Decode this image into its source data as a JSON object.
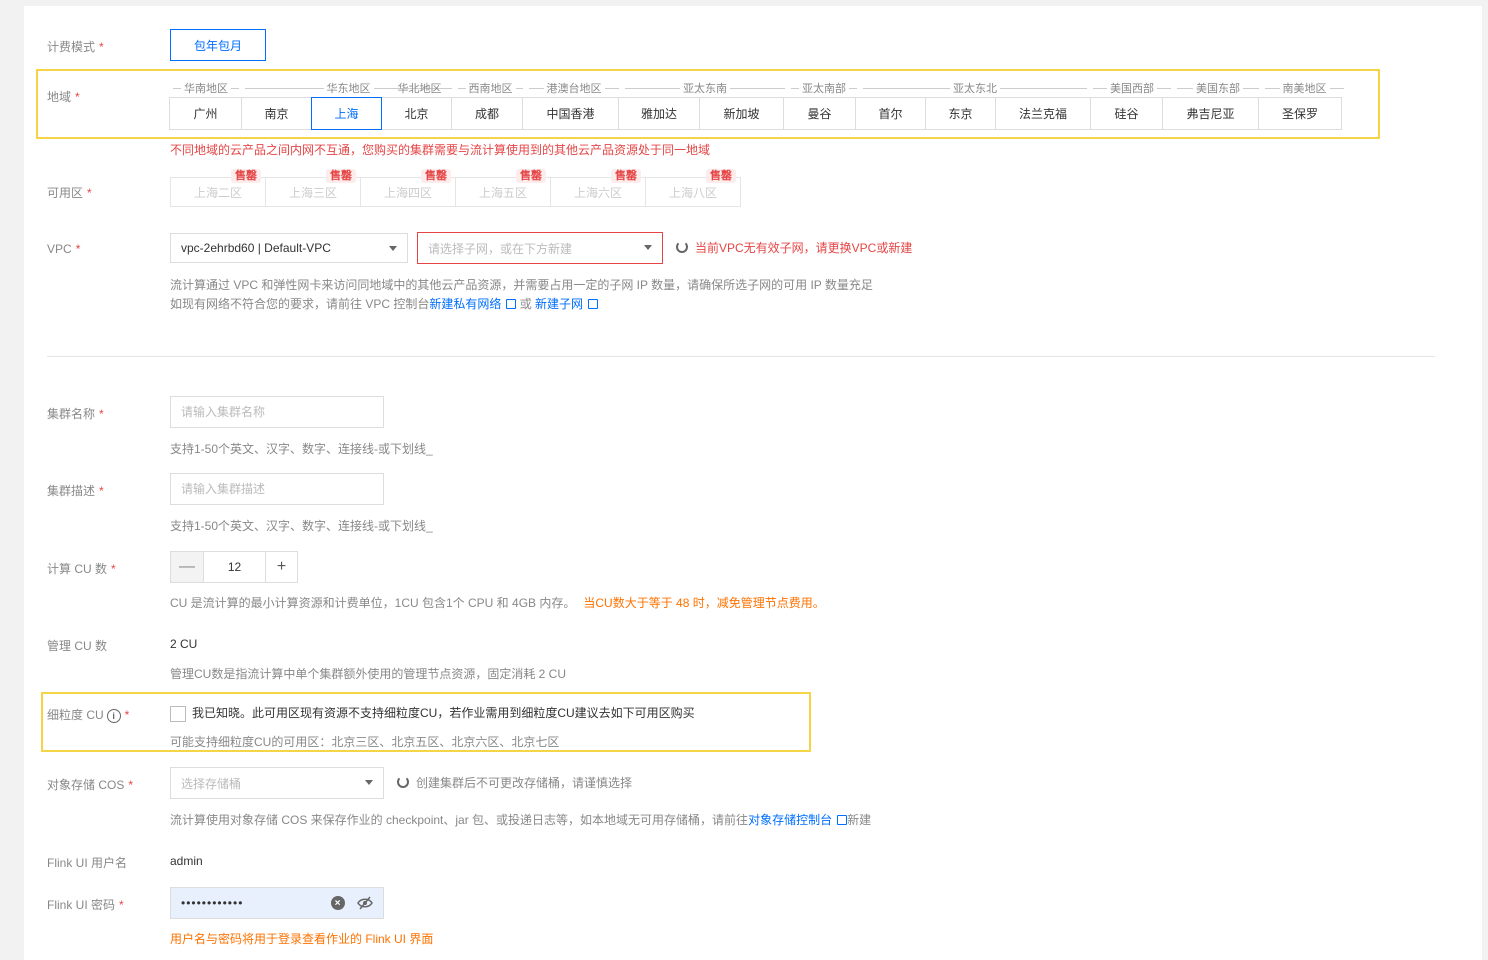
{
  "billing": {
    "label": "计费模式",
    "option": "包年包月"
  },
  "region": {
    "label": "地域",
    "groups": [
      "华南地区",
      "华东地区",
      "华北地区",
      "西南地区",
      "港澳台地区",
      "亚太东南",
      "亚太南部",
      "亚太东北",
      "美国西部",
      "美国东部",
      "南美地区"
    ],
    "items": [
      "广州",
      "南京",
      "上海",
      "北京",
      "成都",
      "中国香港",
      "雅加达",
      "新加坡",
      "曼谷",
      "首尔",
      "东京",
      "法兰克福",
      "硅谷",
      "弗吉尼亚",
      "圣保罗"
    ],
    "selected": "上海",
    "note": "不同地域的云产品之间内网不互通，您购买的集群需要与流计算使用到的其他云产品资源处于同一地域"
  },
  "zone": {
    "label": "可用区",
    "items": [
      "上海二区",
      "上海三区",
      "上海四区",
      "上海五区",
      "上海六区",
      "上海八区"
    ],
    "badge": "售罄"
  },
  "vpc": {
    "label": "VPC",
    "value": "vpc-2ehrbd60 | Default-VPC",
    "subnet_placeholder": "请选择子网，或在下方新建",
    "error": "当前VPC无有效子网，请更换VPC或新建",
    "help1": "流计算通过 VPC 和弹性网卡来访问同地域中的其他云产品资源，并需要占用一定的子网 IP 数量，请确保所选子网的可用 IP 数量充足",
    "help2_prefix": "如现有网络不符合您的要求，请前往 VPC 控制台",
    "link_vpc": "新建私有网络",
    "help2_or": " 或 ",
    "link_subnet": "新建子网"
  },
  "cluster_name": {
    "label": "集群名称",
    "placeholder": "请输入集群名称",
    "help": "支持1-50个英文、汉字、数字、连接线-或下划线_"
  },
  "cluster_desc": {
    "label": "集群描述",
    "placeholder": "请输入集群描述",
    "help": "支持1-50个英文、汉字、数字、连接线-或下划线_"
  },
  "cu": {
    "label": "计算 CU 数",
    "minus": "—",
    "value": "12",
    "plus": "+",
    "help": "CU 是流计算的最小计算资源和计费单位，1CU 包含1个 CPU 和 4GB 内存。",
    "help_warn": "当CU数大于等于 48 时，减免管理节点费用。"
  },
  "mgmt_cu": {
    "label": "管理 CU 数",
    "value": "2 CU",
    "help": "管理CU数是指流计算中单个集群额外使用的管理节点资源，固定消耗 2 CU"
  },
  "fine_cu": {
    "label": "细粒度 CU",
    "info": "i",
    "checkbox_text": "我已知晓。此可用区现有资源不支持细粒度CU，若作业需用到细粒度CU建议去如下可用区购买",
    "help": "可能支持细粒度CU的可用区：北京三区、北京五区、北京六区、北京七区"
  },
  "cos": {
    "label": "对象存储 COS",
    "placeholder": "选择存储桶",
    "note": "创建集群后不可更改存储桶，请谨慎选择",
    "help_prefix": "流计算使用对象存储 COS 来保存作业的 checkpoint、jar 包、或投递日志等，如本地域无可用存储桶，请前往",
    "link": "对象存储控制台",
    "help_suffix": "新建"
  },
  "flink_user": {
    "label": "Flink UI 用户名",
    "value": "admin"
  },
  "flink_pwd": {
    "label": "Flink UI 密码",
    "value": "••••••••••••",
    "clear": "×",
    "help": "用户名与密码将用于登录查看作业的 Flink UI 界面"
  },
  "required_mark": "*"
}
